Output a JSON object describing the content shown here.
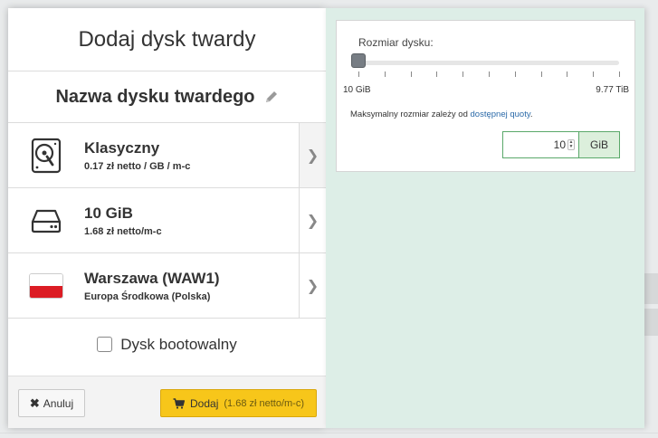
{
  "dialog": {
    "title": "Dodaj dysk twardy",
    "disk_name": "Nazwa dysku twardego",
    "options": [
      {
        "title": "Klasyczny",
        "subtitle": "0.17 zł netto / GB / m-c",
        "icon": "hard-disk-icon"
      },
      {
        "title": "10 GiB",
        "subtitle": "1.68 zł netto/m-c",
        "icon": "drive-icon"
      },
      {
        "title": "Warszawa (WAW1)",
        "subtitle": "Europa Środkowa (Polska)",
        "icon": "poland-flag-icon"
      }
    ],
    "bootable_label": "Dysk bootowalny",
    "bootable_checked": false,
    "cancel_label": "Anuluj",
    "add_label": "Dodaj",
    "add_price": "(1.68 zł netto/m-c)"
  },
  "size_panel": {
    "label": "Rozmiar dysku:",
    "min_label": "10 GiB",
    "max_label": "9.77 TiB",
    "slider_fraction": 0.0,
    "note_prefix": "Maksymalny rozmiar zależy od",
    "note_link": "dostępnej quoty",
    "note_suffix": ".",
    "input_value": "10",
    "unit": "GiB"
  },
  "colors": {
    "accent_yellow": "#f7c61a",
    "panel_teal": "#ddeee7",
    "input_green": "#5aa86a",
    "link_blue": "#2b6aa8"
  }
}
